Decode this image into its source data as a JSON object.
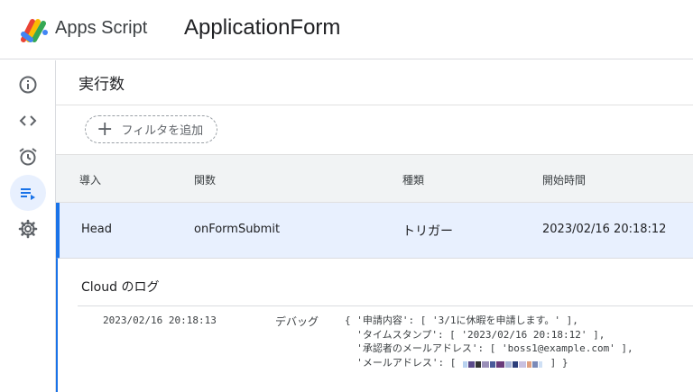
{
  "header": {
    "app_name": "Apps Script",
    "project_name": "ApplicationForm"
  },
  "sidebar": {
    "items": [
      {
        "name": "overview",
        "icon": "info-icon",
        "active": false
      },
      {
        "name": "editor",
        "icon": "code-icon",
        "active": false
      },
      {
        "name": "triggers",
        "icon": "alarm-clock-icon",
        "active": false
      },
      {
        "name": "executions",
        "icon": "executions-list-icon",
        "active": true
      },
      {
        "name": "settings",
        "icon": "gear-icon",
        "active": false
      }
    ]
  },
  "main": {
    "title": "実行数",
    "filter_label": "フィルタを追加",
    "columns": [
      "導入",
      "関数",
      "種類",
      "開始時間"
    ],
    "rows": [
      {
        "deployment": "Head",
        "function": "onFormSubmit",
        "type": "トリガー",
        "start_time": "2023/02/16 20:18:12"
      }
    ],
    "detail": {
      "cloud_label": "Cloud のログ",
      "log": {
        "timestamp": "2023/02/16 20:18:13",
        "level": "デバッグ",
        "lines": [
          "{ '申請内容': [ '3/1に休暇を申請します。' ],",
          "  'タイムスタンプ': [ '2023/02/16 20:18:12' ],",
          "  '承認者のメールアドレス': [ 'boss1@example.com' ],",
          "  'メールアドレス': [ "
        ],
        "last_line_tail": " ] }"
      }
    }
  },
  "colors": {
    "accent": "#1a73e8",
    "selected_row": "#e8f0fe",
    "header_bg": "#f1f3f4"
  }
}
